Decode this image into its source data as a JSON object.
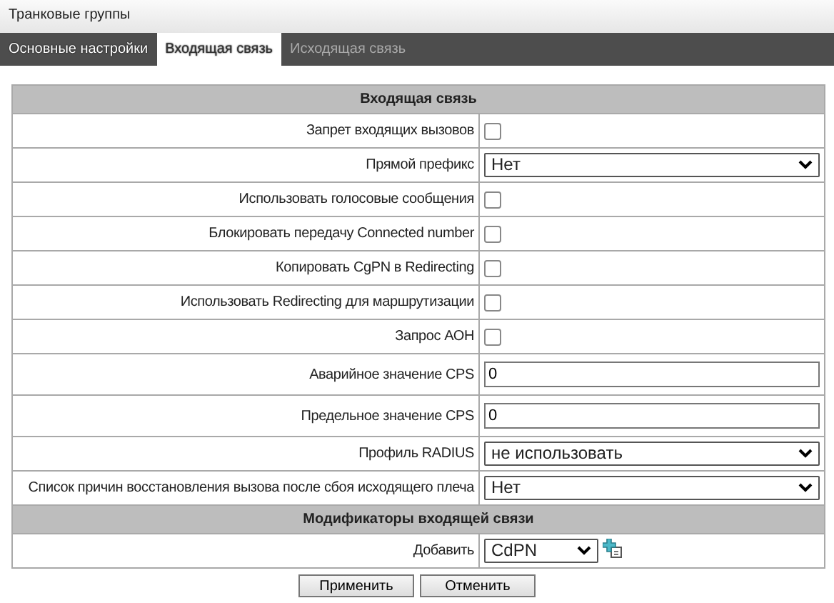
{
  "page_title": "Транковые группы",
  "tabs": [
    {
      "label": "Основные настройки",
      "selected": false,
      "disabled": false
    },
    {
      "label": "Входящая связь",
      "selected": true,
      "disabled": false
    },
    {
      "label": "Исходящая связь",
      "selected": false,
      "disabled": true
    }
  ],
  "sections": [
    {
      "title": "Входящая связь",
      "rows": [
        {
          "label": "Запрет входящих вызовов",
          "kind": "checkbox",
          "checked": false
        },
        {
          "label": "Прямой префикс",
          "kind": "select",
          "value": "Нет"
        },
        {
          "label": "Использовать голосовые сообщения",
          "kind": "checkbox",
          "checked": false
        },
        {
          "label": "Блокировать передачу Connected number",
          "kind": "checkbox",
          "checked": false
        },
        {
          "label": "Копировать CgPN в Redirecting",
          "kind": "checkbox",
          "checked": false
        },
        {
          "label": "Использовать Redirecting для маршрутизации",
          "kind": "checkbox",
          "checked": false
        },
        {
          "label": "Запрос АОН",
          "kind": "checkbox",
          "checked": false
        },
        {
          "label": "Аварийное значение CPS",
          "kind": "text",
          "value": "0"
        },
        {
          "label": "Предельное значение CPS",
          "kind": "text",
          "value": "0"
        },
        {
          "label": "Профиль RADIUS",
          "kind": "select",
          "value": "не использовать"
        },
        {
          "label": "Список причин восстановления вызова после сбоя исходящего плеча",
          "kind": "select",
          "value": "Нет"
        }
      ]
    },
    {
      "title": "Модификаторы входящей связи",
      "rows": [
        {
          "label": "Добавить",
          "kind": "add",
          "value": "CdPN"
        }
      ]
    }
  ],
  "buttons": [
    "Применить",
    "Отменить"
  ]
}
